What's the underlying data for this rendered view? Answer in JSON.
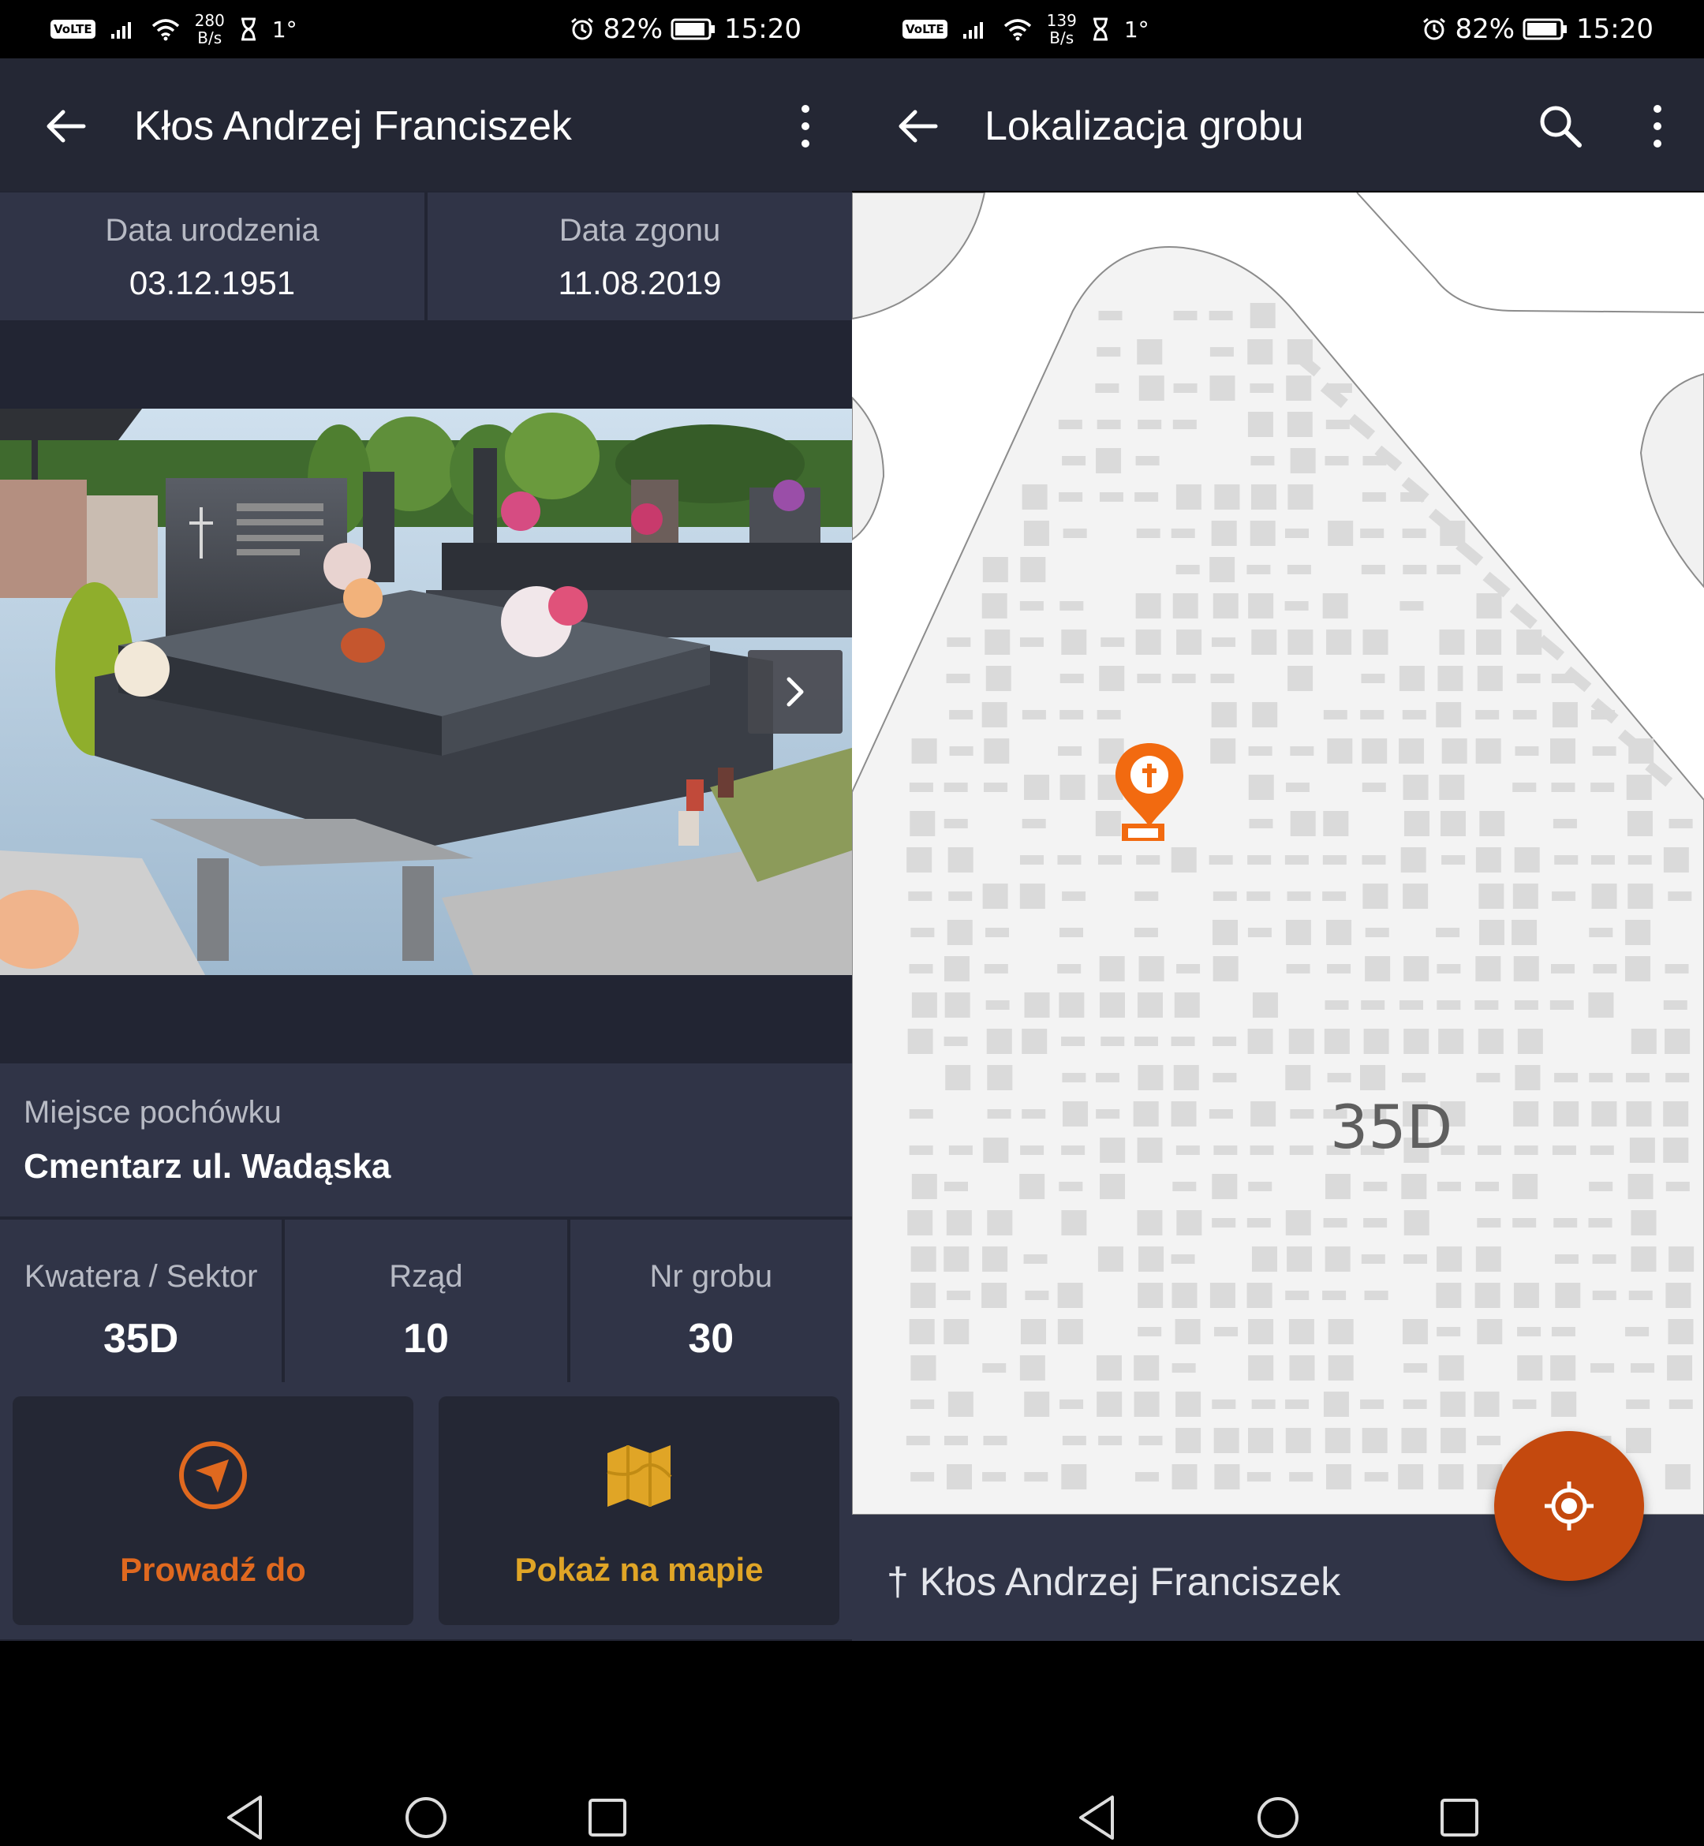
{
  "status_left": {
    "net_speed": "280",
    "net_unit": "B/s",
    "volte": "VoLTE",
    "temp": "1°"
  },
  "status_right": {
    "net_speed": "139",
    "net_unit": "B/s",
    "volte": "VoLTE",
    "temp": "1°"
  },
  "status_common": {
    "battery": "82%",
    "time": "15:20"
  },
  "detail": {
    "title": "Kłos Andrzej Franciszek",
    "birth_label": "Data urodzenia",
    "birth_value": "03.12.1951",
    "death_label": "Data zgonu",
    "death_value": "11.08.2019",
    "place_label": "Miejsce pochówku",
    "place_value": "Cmentarz ul. Wadąska",
    "sector_label": "Kwatera / Sektor",
    "sector_value": "35D",
    "row_label": "Rząd",
    "row_value": "10",
    "grave_label": "Nr grobu",
    "grave_value": "30",
    "action_navigate": "Prowadź do",
    "action_map": "Pokaż na mapie"
  },
  "map_screen": {
    "title": "Lokalizacja grobu",
    "sector_label": "35D",
    "bottom_name": "† Kłos Andrzej Franciszek"
  },
  "colors": {
    "background": "#222533",
    "panel": "#303447",
    "appbar": "#242734",
    "navigate_orange": "#e0691f",
    "map_gold": "#e0a526",
    "pin_orange": "#f26a10",
    "fab_orange": "#c4490e"
  },
  "icons": [
    "back-arrow-icon",
    "more-vert-icon",
    "search-icon",
    "chevron-right-icon",
    "navigation-arrow-icon",
    "map-icon",
    "grave-pin-icon",
    "my-location-icon"
  ]
}
